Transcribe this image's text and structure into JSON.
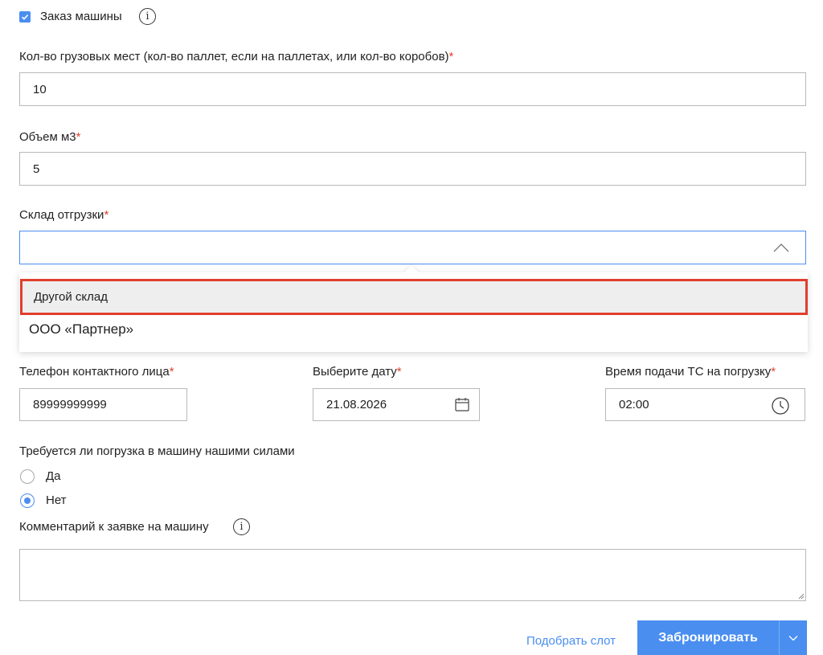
{
  "order_car": {
    "checked": true,
    "label": "Заказ машины",
    "info_glyph": "i"
  },
  "fields": {
    "cargo_places": {
      "label": "Кол-во грузовых мест (кол-во паллет, если на паллетах, или кол-во коробов)",
      "required_mark": "*",
      "value": "10"
    },
    "volume": {
      "label": "Объем м3",
      "required_mark": "*",
      "value": "5"
    },
    "warehouse": {
      "label": "Склад отгрузки",
      "required_mark": "*",
      "value": "",
      "options": [
        "Другой склад",
        "ООО «Партнер»"
      ],
      "highlighted_option": "Другой склад"
    },
    "phone": {
      "label": "Телефон контактного лица",
      "required_mark": "*",
      "value": "89999999999"
    },
    "date": {
      "label": "Выберите дату",
      "required_mark": "*",
      "value": "21.08.2026"
    },
    "time": {
      "label": "Время подачи ТС на погрузку",
      "required_mark": "*",
      "value": "02:00"
    },
    "loading": {
      "label": "Требуется ли погрузка в машину нашими силами",
      "options": [
        {
          "label": "Да",
          "selected": false
        },
        {
          "label": "Нет",
          "selected": true
        }
      ]
    },
    "comment": {
      "label": "Комментарий к заявке на машину",
      "info_glyph": "i",
      "value": ""
    }
  },
  "actions": {
    "pick_slot": "Подобрать слот",
    "book": "Забронировать"
  },
  "colors": {
    "accent": "#4a8ef0",
    "required": "#e0402f",
    "highlight_border": "#e03e2d"
  }
}
